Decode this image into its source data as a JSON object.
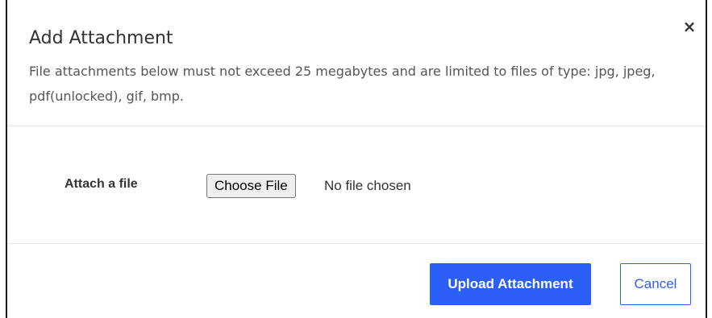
{
  "dialog": {
    "title": "Add Attachment",
    "close_glyph": "×",
    "description": "File attachments below must not exceed 25 megabytes and are limited to files of type: jpg, jpeg, pdf(unlocked), gif, bmp."
  },
  "form": {
    "attach_label": "Attach a file",
    "choose_file_label": "Choose File",
    "file_status": "No file chosen"
  },
  "footer": {
    "upload_label": "Upload Attachment",
    "cancel_label": "Cancel"
  },
  "icons": {
    "close": "close-icon"
  },
  "colors": {
    "primary": "#2b5ff5",
    "text": "#333333",
    "divider": "#e5e5e5"
  }
}
